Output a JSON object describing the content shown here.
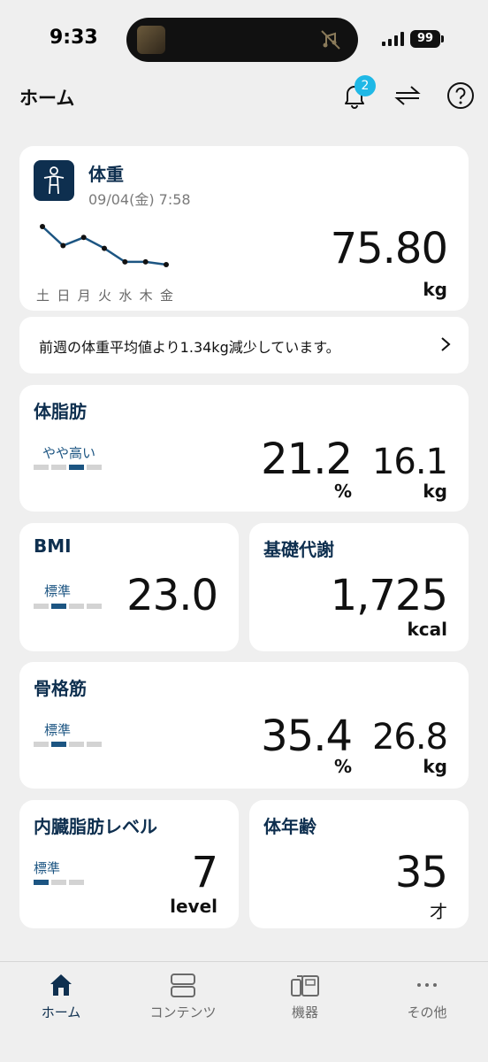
{
  "status_bar": {
    "time": "9:33",
    "battery": "99"
  },
  "header": {
    "title": "ホーム",
    "notification_count": "2"
  },
  "weight_card": {
    "title": "体重",
    "date": "09/04(金) 7:58",
    "value": "75.80",
    "unit": "kg",
    "days": [
      "土",
      "日",
      "月",
      "火",
      "水",
      "木",
      "金"
    ],
    "trend": [
      77.2,
      76.5,
      76.8,
      76.4,
      75.9,
      75.9,
      75.8
    ]
  },
  "message_card": {
    "text": "前週の体重平均値より1.34kg減少しています。"
  },
  "body_fat_card": {
    "title": "体脂肪",
    "level_label": "やや高い",
    "level_index": 3,
    "level_count": 4,
    "percent_value": "21.2",
    "percent_unit": "%",
    "mass_value": "16.1",
    "mass_unit": "kg"
  },
  "bmi_card": {
    "title": "BMI",
    "level_label": "標準",
    "level_index": 2,
    "level_count": 4,
    "value": "23.0"
  },
  "bmr_card": {
    "title": "基礎代謝",
    "value": "1,725",
    "unit": "kcal"
  },
  "skeletal_muscle_card": {
    "title": "骨格筋",
    "level_label": "標準",
    "level_index": 2,
    "level_count": 4,
    "percent_value": "35.4",
    "percent_unit": "%",
    "mass_value": "26.8",
    "mass_unit": "kg"
  },
  "visceral_fat_card": {
    "title": "内臓脂肪レベル",
    "level_label": "標準",
    "level_index": 1,
    "level_count": 3,
    "value": "7",
    "unit": "level"
  },
  "body_age_card": {
    "title": "体年齢",
    "value": "35",
    "unit": "才"
  },
  "tab_bar": {
    "tabs": [
      {
        "label": "ホーム",
        "icon": "home-icon",
        "active": true
      },
      {
        "label": "コンテンツ",
        "icon": "contents-icon",
        "active": false
      },
      {
        "label": "機器",
        "icon": "devices-icon",
        "active": false
      },
      {
        "label": "その他",
        "icon": "more-icon",
        "active": false
      }
    ]
  },
  "colors": {
    "accent": "#0e2f4f",
    "level": "#1c5582",
    "badge": "#1fb8e6",
    "background": "#efefef"
  }
}
